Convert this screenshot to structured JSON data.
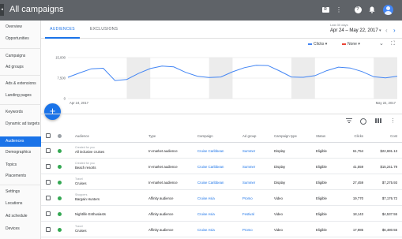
{
  "header": {
    "title": "All campaigns",
    "collapse_icon": "◂",
    "report_icon_glyph": "R"
  },
  "sidebar": {
    "items": [
      {
        "label": "Overview"
      },
      {
        "label": "Opportunities"
      },
      {
        "label": "Campaigns"
      },
      {
        "label": "Ad groups"
      },
      {
        "label": "Ads & extensions"
      },
      {
        "label": "Landing pages"
      },
      {
        "label": "Keywords"
      },
      {
        "label": "Dynamic ad targets"
      },
      {
        "label": "Audiences"
      },
      {
        "label": "Demographics"
      },
      {
        "label": "Topics"
      },
      {
        "label": "Placements"
      },
      {
        "label": "Settings"
      },
      {
        "label": "Locations"
      },
      {
        "label": "Ad schedule"
      },
      {
        "label": "Devices"
      }
    ],
    "active": "Audiences"
  },
  "tabs": [
    {
      "label": "AUDIENCES",
      "selected": true
    },
    {
      "label": "EXCLUSIONS",
      "selected": false
    }
  ],
  "date": {
    "label": "Last 30 days",
    "range": "Apr 24 – May 22, 2017"
  },
  "chart_controls": {
    "metric1": "Clicks",
    "metric1_color": "#4285f4",
    "metric2": "None",
    "metric2_color": "#ea4335"
  },
  "chart_data": {
    "type": "line",
    "x_labels": [
      "Apr 24, 2017",
      "May 22, 2017"
    ],
    "y_ticks": [
      "15,000",
      "7,500",
      "0"
    ],
    "ylim": [
      0,
      15000
    ],
    "grid": true,
    "series": [
      {
        "color": "#4285f4",
        "values": [
          7800,
          9400,
          10900,
          11100,
          6600,
          7000,
          9200,
          11000,
          11900,
          11600,
          9600,
          8200,
          7700,
          7900,
          9800,
          11300,
          12200,
          12100,
          10100,
          7900,
          7800,
          8400,
          10200,
          11500,
          11200,
          9900,
          8000,
          7600,
          8200
        ]
      }
    ]
  },
  "fab": {
    "label": "+"
  },
  "table": {
    "columns": [
      "Audience",
      "Type",
      "Campaign",
      "Ad group",
      "Campaign type",
      "Status",
      "Clicks",
      "Cost"
    ],
    "rows": [
      {
        "sub": "Created for you",
        "name": "All inclusive cruises",
        "type": "In-market audience",
        "campaign": "Cruise Caribbean",
        "adgroup": "Summer",
        "ctype": "Display",
        "status": "Eligible",
        "clicks": "61,754",
        "cost": "$22,691.13"
      },
      {
        "sub": "Created for you",
        "name": "Beach resorts",
        "type": "In-market audience",
        "campaign": "Cruise Caribbean",
        "adgroup": "Summer",
        "ctype": "Display",
        "status": "Eligible",
        "clicks": "41,559",
        "cost": "$15,241.79"
      },
      {
        "sub": "Travel",
        "name": "Cruises",
        "type": "In-market audience",
        "campaign": "Cruise Caribbean",
        "adgroup": "Summer",
        "ctype": "Display",
        "status": "Eligible",
        "clicks": "27,459",
        "cost": "$7,275.93"
      },
      {
        "sub": "Shoppers",
        "name": "Bargain Hunters",
        "type": "Affinity audience",
        "campaign": "Cruise Asia",
        "adgroup": "Promo",
        "ctype": "Video",
        "status": "Eligible",
        "clicks": "19,770",
        "cost": "$7,176.72"
      },
      {
        "sub": "",
        "name": "Nightlife Enthusiasts",
        "type": "Affinity audience",
        "campaign": "Cruise Asia",
        "adgroup": "Festival",
        "ctype": "Video",
        "status": "Eligible",
        "clicks": "18,143",
        "cost": "$4,537.55"
      },
      {
        "sub": "Travel",
        "name": "Cruises",
        "type": "Affinity audience",
        "campaign": "Cruise Asia",
        "adgroup": "Promo",
        "ctype": "Video",
        "status": "Eligible",
        "clicks": "17,985",
        "cost": "$6,480.55"
      }
    ]
  }
}
